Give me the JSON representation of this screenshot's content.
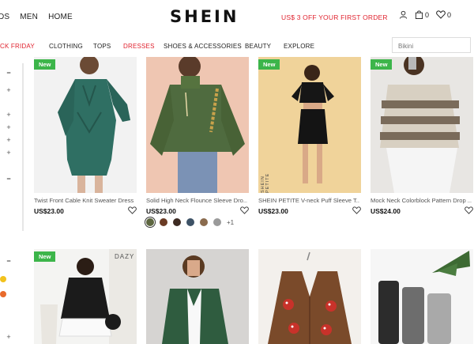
{
  "header": {
    "left_links": [
      "IDS",
      "MEN",
      "HOME"
    ],
    "logo": "SHEIN",
    "promo": "US$ 3 OFF YOUR FIRST ORDER",
    "bag_count": "0",
    "wishlist_count": "0",
    "icons": [
      "user-icon",
      "bag-icon",
      "heart-icon"
    ]
  },
  "nav": {
    "items": [
      "CK FRIDAY",
      "CLOTHING",
      "TOPS",
      "DRESSES",
      "SHOES & ACCESSORIES",
      "BEAUTY",
      "EXPLORE"
    ],
    "active": "DRESSES",
    "search_placeholder": "Bikini"
  },
  "filters": {
    "symbols": [
      "−",
      "+",
      "+",
      "+",
      "+",
      "+",
      "−",
      "−",
      "+"
    ]
  },
  "products": [
    {
      "title": "Twist Front Cable Knit Sweater Dress",
      "price": "US$23.00",
      "badge": "New",
      "image": "green cable knit sweater dress"
    },
    {
      "title": "Solid High Neck Flounce Sleeve Dro...",
      "price": "US$23.00",
      "badge": "",
      "image": "green turtleneck sweater with jeans",
      "swatch_more": "+1"
    },
    {
      "title": "SHEIN PETITE V-neck Puff Sleeve T...",
      "price": "US$23.00",
      "badge": "New",
      "image": "black puff sleeve crop top and skirt set",
      "image_text": "SHEIN PETITE"
    },
    {
      "title": "Mock Neck Colorblock Pattern Drop ...",
      "price": "US$24.00",
      "badge": "New",
      "image": "striped colorblock knit sweater"
    },
    {
      "badge": "New",
      "image": "black sweater with white pleated skirt",
      "image_text": "DAZY"
    },
    {
      "badge": "",
      "image": "green blazer over white top"
    },
    {
      "badge": "",
      "image": "brown mushroom print cardigan"
    },
    {
      "badge": "",
      "image": "grey and black jogger pants set"
    }
  ],
  "colors": {
    "accent_red": "#e0232f",
    "badge_green": "#3cb54a",
    "swatches": [
      "#5d6640",
      "#6a3b24",
      "#3d2a22",
      "#3d5266",
      "#8a6b4e",
      "#9a9a9a"
    ]
  }
}
